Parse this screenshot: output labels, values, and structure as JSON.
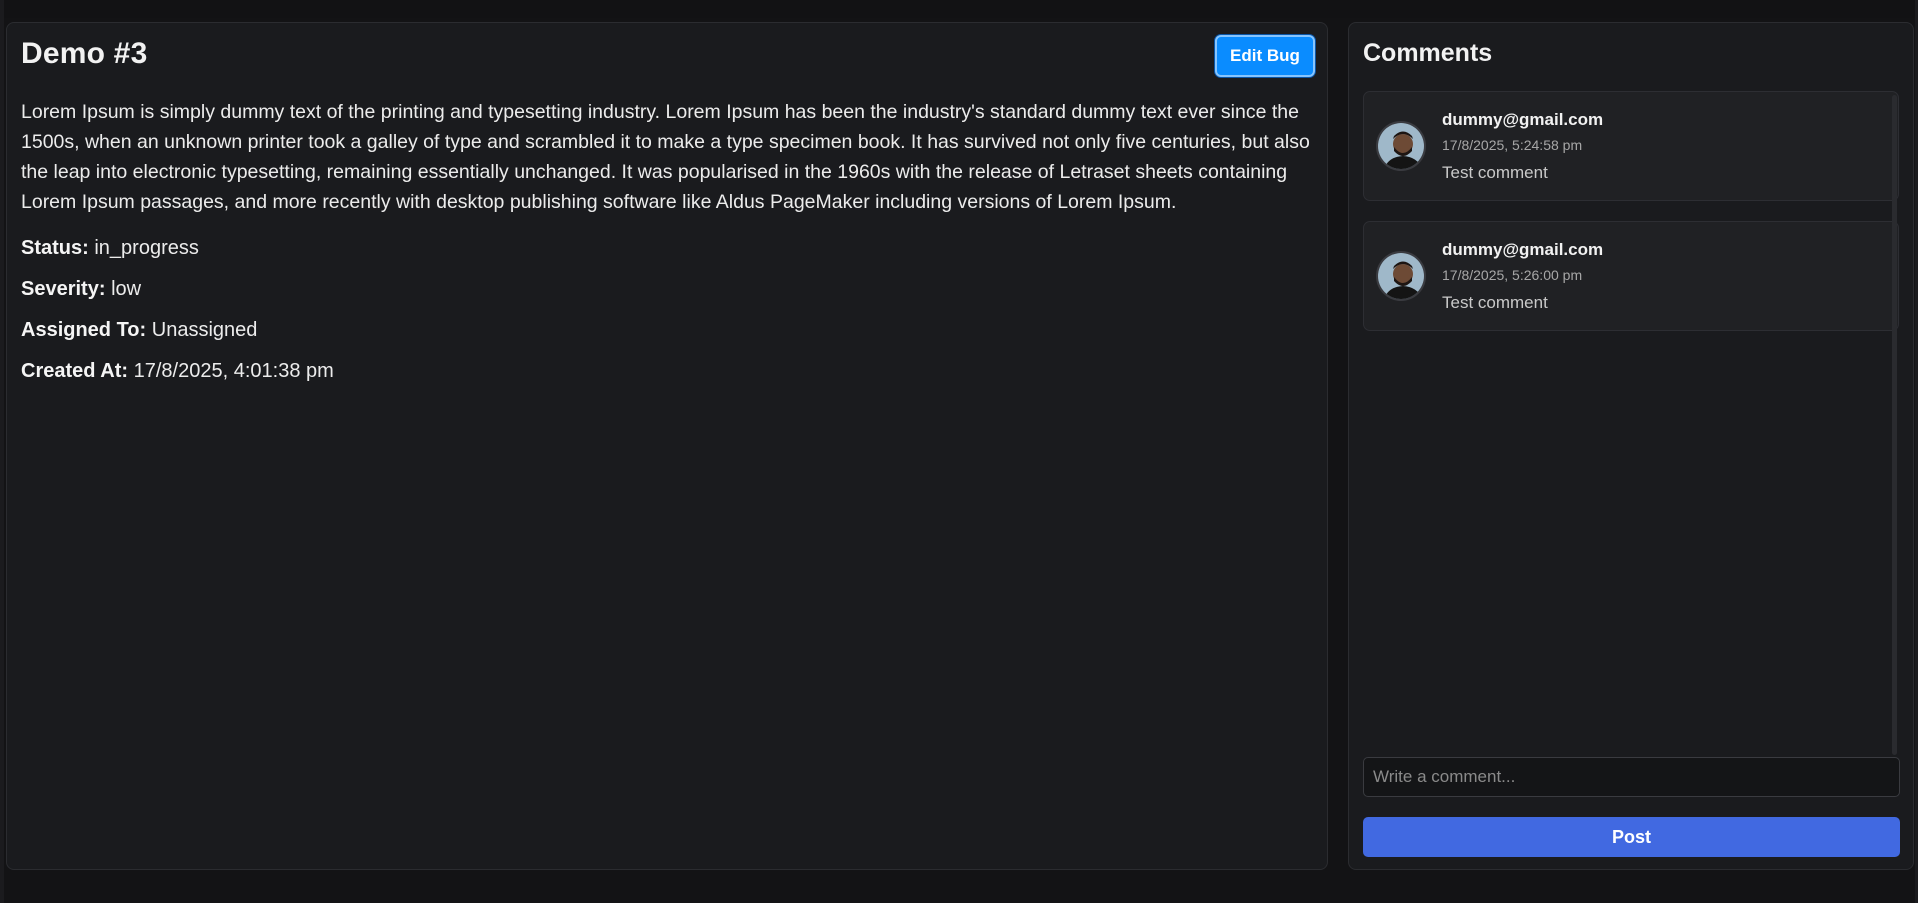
{
  "bug": {
    "title": "Demo #3",
    "edit_label": "Edit Bug",
    "description": "Lorem Ipsum is simply dummy text of the printing and typesetting industry. Lorem Ipsum has been the industry's standard dummy text ever since the 1500s, when an unknown printer took a galley of type and scrambled it to make a type specimen book. It has survived not only five centuries, but also the leap into electronic typesetting, remaining essentially unchanged. It was popularised in the 1960s with the release of Letraset sheets containing Lorem Ipsum passages, and more recently with desktop publishing software like Aldus PageMaker including versions of Lorem Ipsum.",
    "fields": [
      {
        "label": "Status:",
        "value": "in_progress"
      },
      {
        "label": "Severity:",
        "value": "low"
      },
      {
        "label": "Assigned To:",
        "value": "Unassigned"
      },
      {
        "label": "Created At:",
        "value": "17/8/2025, 4:01:38 pm"
      }
    ]
  },
  "comments": {
    "title": "Comments",
    "items": [
      {
        "email": "dummy@gmail.com",
        "time": "17/8/2025, 5:24:58 pm",
        "text": "Test comment",
        "avatar": "user-avatar-icon"
      },
      {
        "email": "dummy@gmail.com",
        "time": "17/8/2025, 5:26:00 pm",
        "text": "Test comment",
        "avatar": "user-avatar-icon"
      }
    ],
    "input_placeholder": "Write a comment...",
    "input_value": "",
    "post_label": "Post"
  },
  "colors": {
    "background": "#131315",
    "panel": "#1a1b1e",
    "edit_button": "#0a8cff",
    "post_button": "#4169e1"
  }
}
